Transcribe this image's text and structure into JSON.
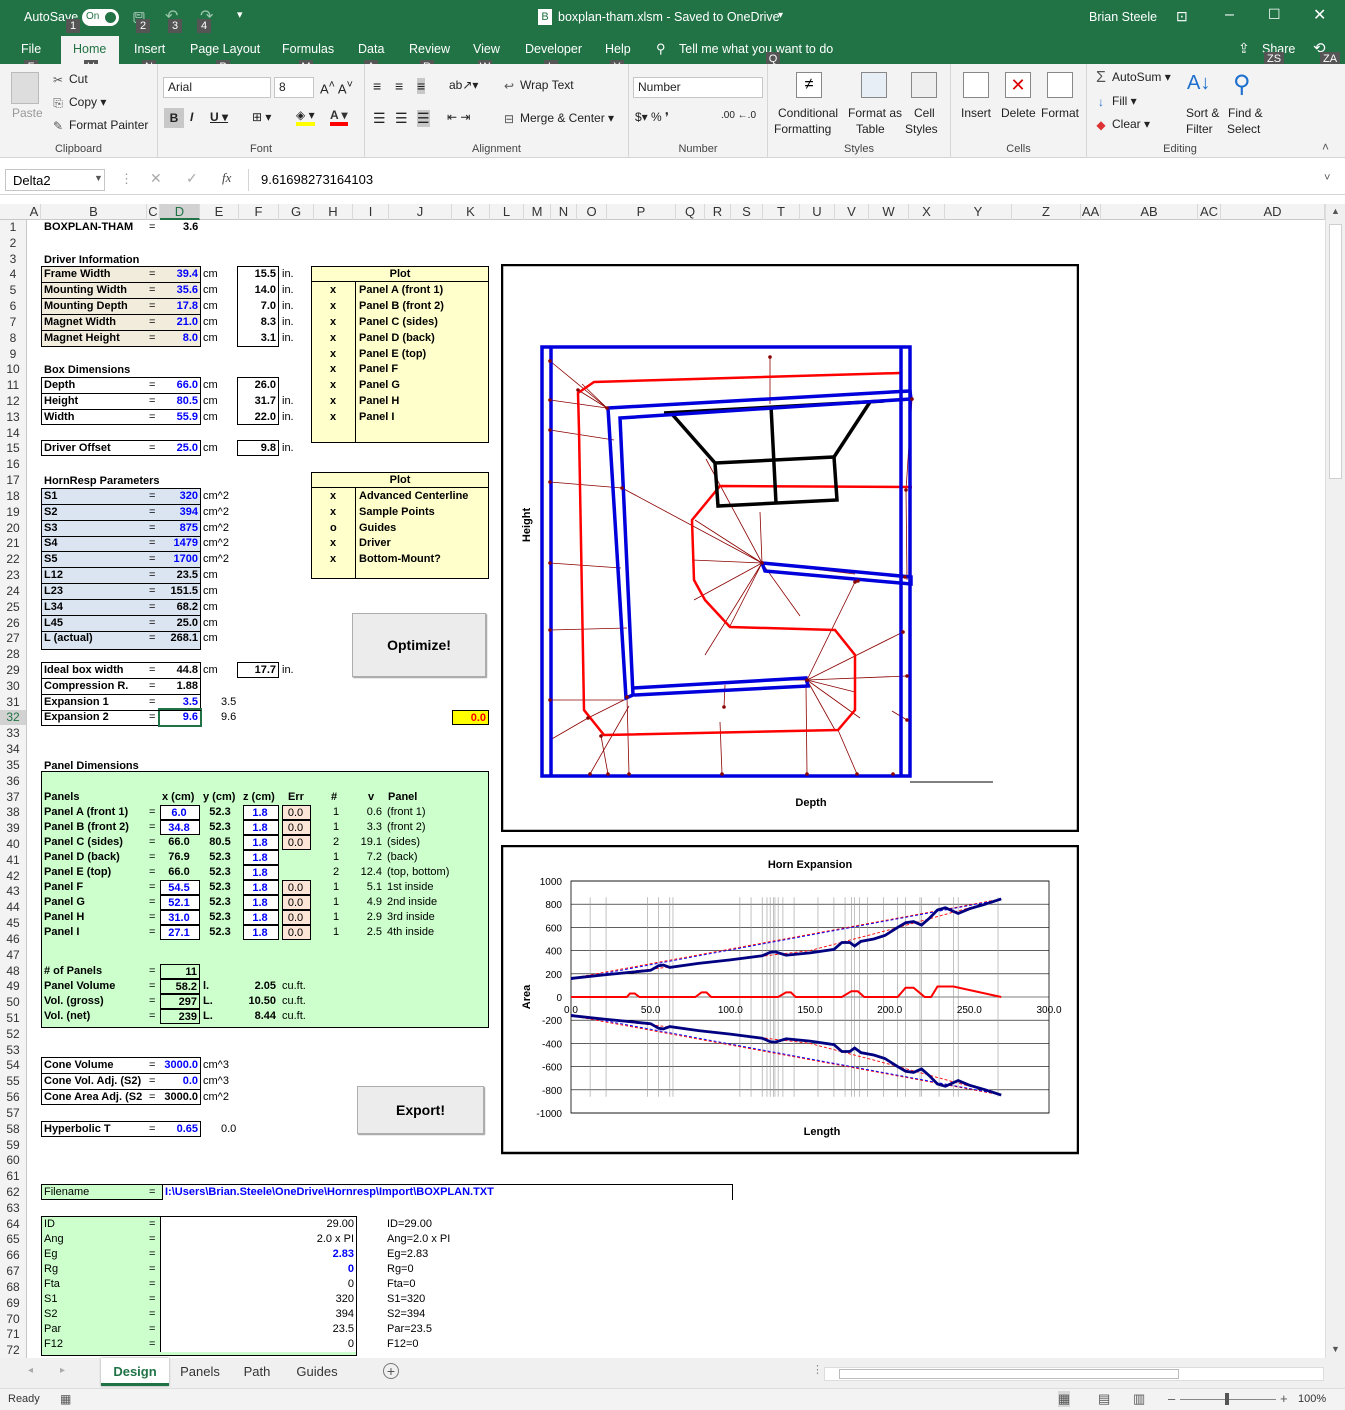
{
  "titlebar": {
    "autosave": "AutoSave",
    "autosave_state": "On",
    "doc_title": "boxplan-tham.xlsm  -  Saved to OneDrive",
    "user": "Brian Steele"
  },
  "tabs": [
    "File",
    "Home",
    "Insert",
    "Page Layout",
    "Formulas",
    "Data",
    "Review",
    "View",
    "Developer",
    "Help"
  ],
  "tell_me": "Tell me what you want to do",
  "share": "Share",
  "keytips": {
    "autosave": "1",
    "save": "2",
    "undo": "3",
    "redo": "4",
    "file": "F",
    "home": "H",
    "insert": "N",
    "pagelayout": "P",
    "formulas": "M",
    "data": "A",
    "review": "R",
    "view": "W",
    "developer": "L",
    "help": "Y",
    "tellme": "Q",
    "share": "ZS",
    "comment": "ZA"
  },
  "ribbon": {
    "clipboard": {
      "paste": "Paste",
      "cut": "Cut",
      "copy": "Copy",
      "format_painter": "Format Painter",
      "label": "Clipboard"
    },
    "font": {
      "name": "Arial",
      "size": "8",
      "label": "Font"
    },
    "alignment": {
      "wrap": "Wrap Text",
      "merge": "Merge & Center",
      "label": "Alignment"
    },
    "number": {
      "format": "Number",
      "label": "Number"
    },
    "styles": {
      "conditional": "Conditional",
      "conditional2": "Formatting",
      "format_as": "Format as",
      "format_as2": "Table",
      "cell": "Cell",
      "cell2": "Styles",
      "label": "Styles"
    },
    "cells": {
      "insert": "Insert",
      "delete": "Delete",
      "format": "Format",
      "label": "Cells"
    },
    "editing": {
      "autosum": "AutoSum",
      "fill": "Fill",
      "clear": "Clear",
      "sort": "Sort &",
      "sort2": "Filter",
      "find": "Find &",
      "find2": "Select",
      "label": "Editing"
    }
  },
  "formula_bar": {
    "name_box": "Delta2",
    "formula": "9.61698273164103"
  },
  "columns": [
    "A",
    "B",
    "C",
    "D",
    "E",
    "F",
    "G",
    "H",
    "I",
    "J",
    "K",
    "L",
    "M",
    "N",
    "O",
    "P",
    "Q",
    "R",
    "S",
    "T",
    "U",
    "V",
    "W",
    "X",
    "Y",
    "Z",
    "AA",
    "AB",
    "AC",
    "AD"
  ],
  "sheet": {
    "title": "BOXPLAN-THAM",
    "title_eq": "=",
    "title_val": "3.6",
    "driver_info": "Driver Information",
    "driver": [
      {
        "l": "Frame Width",
        "v": "39.4",
        "u": "cm",
        "in": "15.5"
      },
      {
        "l": "Mounting Width",
        "v": "35.6",
        "u": "cm",
        "in": "14.0"
      },
      {
        "l": "Mounting Depth",
        "v": "17.8",
        "u": "cm",
        "in": "7.0"
      },
      {
        "l": "Magnet Width",
        "v": "21.0",
        "u": "cm",
        "in": "8.3"
      },
      {
        "l": "Magnet Height",
        "v": "8.0",
        "u": "cm",
        "in": "3.1"
      }
    ],
    "box_dims": "Box Dimensions",
    "box": [
      {
        "l": "Depth",
        "v": "66.0",
        "u": "cm",
        "in": "26.0",
        "iu": ""
      },
      {
        "l": "Height",
        "v": "80.5",
        "u": "cm",
        "in": "31.7",
        "iu": "in."
      },
      {
        "l": "Width",
        "v": "55.9",
        "u": "cm",
        "in": "22.0",
        "iu": "in."
      }
    ],
    "offset": {
      "l": "Driver Offset",
      "v": "25.0",
      "u": "cm",
      "in": "9.8",
      "iu": "in."
    },
    "in_unit": "in.",
    "eq": "=",
    "plot1": {
      "header": "Plot",
      "rows": [
        [
          "x",
          "Panel A (front 1)"
        ],
        [
          "x",
          "Panel B (front 2)"
        ],
        [
          "x",
          "Panel C (sides)"
        ],
        [
          "x",
          "Panel D (back)"
        ],
        [
          "x",
          "Panel E (top)"
        ],
        [
          "x",
          "Panel F"
        ],
        [
          "x",
          "Panel G"
        ],
        [
          "x",
          "Panel H"
        ],
        [
          "x",
          "Panel I"
        ]
      ]
    },
    "hr_params": "HornResp Parameters",
    "hr": [
      {
        "l": "S1",
        "v": "320",
        "u": "cm^2"
      },
      {
        "l": "S2",
        "v": "394",
        "u": "cm^2"
      },
      {
        "l": "S3",
        "v": "875",
        "u": "cm^2"
      },
      {
        "l": "S4",
        "v": "1479",
        "u": "cm^2"
      },
      {
        "l": "S5",
        "v": "1700",
        "u": "cm^2"
      },
      {
        "l": "L12",
        "v": "23.5",
        "u": "cm"
      },
      {
        "l": "L23",
        "v": "151.5",
        "u": "cm"
      },
      {
        "l": "L34",
        "v": "68.2",
        "u": "cm"
      },
      {
        "l": "L45",
        "v": "25.0",
        "u": "cm"
      },
      {
        "l": "L (actual)",
        "v": "268.1",
        "u": "cm"
      }
    ],
    "plot2": {
      "header": "Plot",
      "rows": [
        [
          "x",
          "Advanced Centerline"
        ],
        [
          "x",
          "Sample Points"
        ],
        [
          "o",
          "Guides"
        ],
        [
          "x",
          "Driver"
        ],
        [
          "x",
          "Bottom-Mount?"
        ]
      ]
    },
    "optimize": "Optimize!",
    "export": "Export!",
    "ideal": {
      "l": "Ideal box width",
      "v": "44.8",
      "u": "cm",
      "in": "17.7",
      "iu": "in."
    },
    "comp": {
      "l": "Compression R.",
      "v": "1.88"
    },
    "exp1": {
      "l": "Expansion 1",
      "v": "3.5",
      "e": "3.5"
    },
    "exp2": {
      "l": "Expansion 2",
      "v": "9.6",
      "e": "9.6"
    },
    "err_cell": "0.0",
    "panel_dims": "Panel Dimensions",
    "panel_hdr": [
      "Panels",
      "x (cm)",
      "y (cm)",
      "z (cm)",
      "Err",
      "#",
      "v",
      "Panel"
    ],
    "panels": [
      [
        "Panel A (front 1)",
        "6.0",
        "52.3",
        "1.8",
        "0.0",
        "1",
        "0.6",
        "(front 1)"
      ],
      [
        "Panel B (front 2)",
        "34.8",
        "52.3",
        "1.8",
        "0.0",
        "1",
        "3.3",
        "(front 2)"
      ],
      [
        "Panel C (sides)",
        "66.0",
        "80.5",
        "1.8",
        "0.0",
        "2",
        "19.1",
        "(sides)"
      ],
      [
        "Panel D (back)",
        "76.9",
        "52.3",
        "1.8",
        "",
        "1",
        "7.2",
        "(back)"
      ],
      [
        "Panel E (top)",
        "66.0",
        "52.3",
        "1.8",
        "",
        "2",
        "12.4",
        "(top, bottom)"
      ],
      [
        "Panel F",
        "54.5",
        "52.3",
        "1.8",
        "0.0",
        "1",
        "5.1",
        "1st inside"
      ],
      [
        "Panel G",
        "52.1",
        "52.3",
        "1.8",
        "0.0",
        "1",
        "4.9",
        "2nd inside"
      ],
      [
        "Panel H",
        "31.0",
        "52.3",
        "1.8",
        "0.0",
        "1",
        "2.9",
        "3rd inside"
      ],
      [
        "Panel I",
        "27.1",
        "52.3",
        "1.8",
        "0.0",
        "1",
        "2.5",
        "4th inside"
      ]
    ],
    "num_panels": {
      "l": "# of Panels",
      "v": "11"
    },
    "vols": [
      {
        "l": "Panel Volume",
        "v": "58.2",
        "u": "l.",
        "cf": "2.05",
        "cu": "cu.ft."
      },
      {
        "l": "Vol. (gross)",
        "v": "297",
        "u": "L.",
        "cf": "10.50",
        "cu": "cu.ft."
      },
      {
        "l": "Vol. (net)",
        "v": "239",
        "u": "L.",
        "cf": "8.44",
        "cu": "cu.ft."
      }
    ],
    "cone": [
      {
        "l": "Cone Volume",
        "v": "3000.0",
        "u": "cm^3"
      },
      {
        "l": "Cone Vol. Adj. (S2)",
        "v": "0.0",
        "u": "cm^3"
      },
      {
        "l": "Cone Area Adj. (S2",
        "v": "3000.0",
        "u": "cm^2"
      }
    ],
    "hyper": {
      "l": "Hyperbolic T",
      "v": "0.65",
      "e": "0.0"
    },
    "filename": {
      "l": "Filename",
      "v": "I:\\Users\\Brian.Steele\\OneDrive\\Hornresp\\Import\\BOXPLAN.TXT"
    },
    "params": [
      [
        "ID",
        "29.00",
        "ID=29.00"
      ],
      [
        "Ang",
        "2.0 x PI",
        "Ang=2.0 x PI"
      ],
      [
        "Eg",
        "2.83",
        "Eg=2.83"
      ],
      [
        "Rg",
        "0",
        "Rg=0"
      ],
      [
        "Fta",
        "0",
        "Fta=0"
      ],
      [
        "S1",
        "320",
        "S1=320"
      ],
      [
        "S2",
        "394",
        "S2=394"
      ],
      [
        "Par",
        "23.5",
        "Par=23.5"
      ],
      [
        "F12",
        "0",
        "F12=0"
      ]
    ]
  },
  "diagram": {
    "xlabel": "Depth",
    "ylabel": "Height"
  },
  "chart_data": {
    "type": "line",
    "title": "Horn Expansion",
    "xlabel": "Length",
    "ylabel": "Area",
    "xlim": [
      0,
      300
    ],
    "ylim": [
      -1000,
      1000
    ],
    "xticks": [
      "0.0",
      "50.0",
      "100.0",
      "150.0",
      "200.0",
      "250.0",
      "300.0"
    ],
    "yticks": [
      "1000",
      "800",
      "600",
      "400",
      "200",
      "0",
      "-200",
      "-400",
      "-600",
      "-800",
      "-1000"
    ],
    "series": [
      {
        "name": "",
        "color": "#000080",
        "x": [
          0,
          20,
          50,
          55,
          58,
          62,
          80,
          100,
          120,
          125,
          128,
          135,
          150,
          165,
          170,
          175,
          178,
          182,
          190,
          197,
          205,
          210,
          215,
          220,
          225,
          230,
          235,
          243,
          250,
          260,
          270
        ],
        "y": [
          160,
          190,
          230,
          270,
          275,
          255,
          290,
          320,
          355,
          385,
          390,
          360,
          380,
          410,
          470,
          470,
          440,
          480,
          500,
          530,
          600,
          640,
          650,
          620,
          680,
          750,
          770,
          720,
          760,
          800,
          845
        ]
      },
      {
        "name": "",
        "color": "#000080",
        "x": [
          0,
          20,
          50,
          55,
          58,
          62,
          80,
          100,
          120,
          125,
          128,
          135,
          150,
          165,
          170,
          175,
          178,
          182,
          190,
          197,
          205,
          210,
          215,
          220,
          225,
          230,
          235,
          243,
          250,
          260,
          270
        ],
        "y": [
          -160,
          -190,
          -230,
          -270,
          -275,
          -255,
          -290,
          -320,
          -355,
          -385,
          -390,
          -360,
          -380,
          -410,
          -470,
          -470,
          -440,
          -480,
          -500,
          -530,
          -600,
          -640,
          -650,
          -620,
          -680,
          -750,
          -770,
          -720,
          -760,
          -800,
          -845
        ]
      },
      {
        "name": "",
        "color": "#ff0000",
        "x": [
          0,
          35,
          37,
          40,
          43,
          60,
          78,
          82,
          85,
          88,
          100,
          130,
          135,
          138,
          141,
          170,
          176,
          180,
          184,
          205,
          210,
          215,
          222,
          226,
          230,
          240,
          270
        ],
        "y": [
          0,
          0,
          30,
          30,
          0,
          0,
          0,
          40,
          40,
          0,
          0,
          0,
          40,
          40,
          0,
          0,
          50,
          50,
          0,
          0,
          80,
          80,
          0,
          0,
          90,
          90,
          0
        ]
      }
    ]
  }
}
